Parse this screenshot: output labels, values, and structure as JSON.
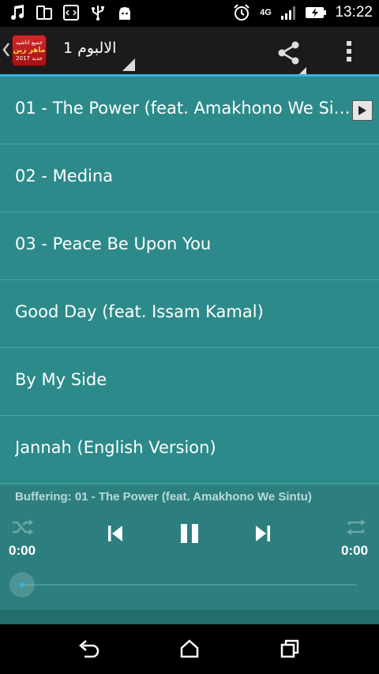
{
  "status_bar": {
    "time": "13:22",
    "network": "4G",
    "left_icons": [
      "music-icon",
      "device-icon",
      "code-icon",
      "usb-icon",
      "android-icon"
    ],
    "right_icons": [
      "alarm-icon",
      "4g-icon",
      "signal-icon",
      "battery-charging-icon"
    ]
  },
  "action_bar": {
    "logo": {
      "line1": "جميع اناشيد",
      "line2": "ماهر زين",
      "line3": "جديد 2017"
    },
    "title": "الالبوم 1"
  },
  "tracks": [
    {
      "title": "01 - The Power (feat. Amakhono We Sintu)",
      "playing": true
    },
    {
      "title": "02 - Medina",
      "playing": false
    },
    {
      "title": "03 - Peace Be Upon You",
      "playing": false
    },
    {
      "title": "Good Day (feat. Issam Kamal)",
      "playing": false
    },
    {
      "title": "By My Side",
      "playing": false
    },
    {
      "title": "Jannah (English Version)",
      "playing": false
    }
  ],
  "player": {
    "status": "Buffering: 01 - The Power (feat. Amakhono We Sintu)",
    "elapsed": "0:00",
    "duration": "0:00",
    "progress": 0,
    "state": "playing"
  },
  "colors": {
    "list_bg": "#2d8a8a",
    "player_bg": "#2d7f7f",
    "accent": "#33b5e5"
  }
}
